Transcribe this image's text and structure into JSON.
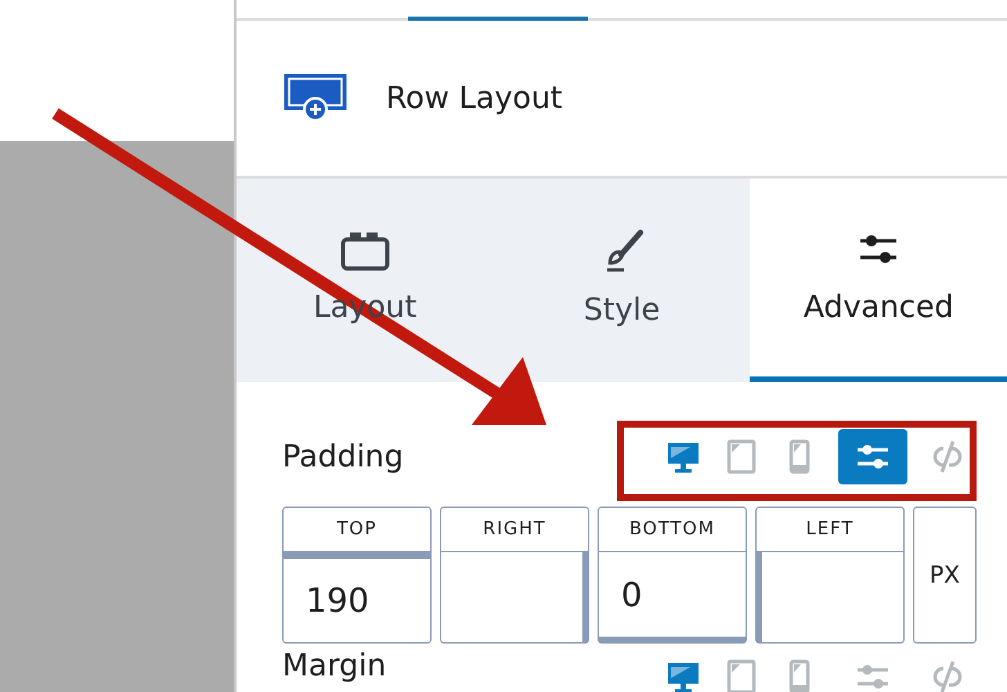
{
  "header": {
    "title": "Row Layout"
  },
  "tabs": [
    {
      "label": "Layout",
      "kind": "layout",
      "selected": false
    },
    {
      "label": "Style",
      "kind": "style",
      "selected": false
    },
    {
      "label": "Advanced",
      "kind": "advanced",
      "selected": true
    }
  ],
  "sections": [
    {
      "label": "Padding",
      "devices": [
        {
          "kind": "desktop",
          "selected": true
        },
        {
          "kind": "tablet",
          "selected": false
        },
        {
          "kind": "mobile",
          "selected": false
        }
      ],
      "custom_on": true,
      "linked": false,
      "fields": [
        {
          "label": "TOP",
          "kind": "top",
          "value": "190"
        },
        {
          "label": "RIGHT",
          "kind": "right"
        },
        {
          "label": "BOTTOM",
          "kind": "bottom",
          "value": "0"
        },
        {
          "label": "LEFT",
          "kind": "left"
        }
      ],
      "unit": "PX"
    },
    {
      "label": "Margin",
      "devices": [
        {
          "kind": "desktop",
          "selected": true
        },
        {
          "kind": "tablet",
          "selected": false
        },
        {
          "kind": "mobile",
          "selected": false
        }
      ],
      "custom_on": false,
      "linked": false
    }
  ],
  "annotations": {
    "arrow": true,
    "highlight_frame": true
  }
}
